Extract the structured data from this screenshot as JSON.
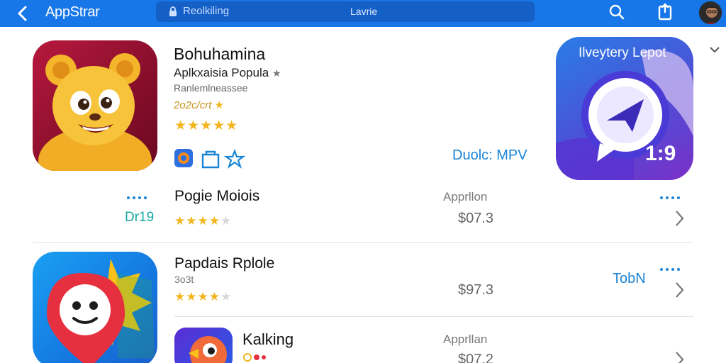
{
  "topbar": {
    "brand": "AppStrar",
    "search_placeholder": "Reolkiling",
    "search_center": "Lavrie",
    "icons": [
      "back-chevron-icon",
      "lock-icon",
      "search-icon",
      "share-icon",
      "avatar"
    ]
  },
  "featured": {
    "title": "Bohuhamina",
    "subtitle": "Aplkxaisia Popula",
    "small": "Ranlemlneassee",
    "year_text": "2o2c/crt",
    "rating_stars": 5,
    "promo": "Duolc: MPV",
    "big_card": {
      "title": "Ilveytery Lepot",
      "number": "1:9"
    }
  },
  "list": [
    {
      "title": "Pogie Moiois",
      "category": "Apprllon",
      "price": "$07.3",
      "rating": 4,
      "left_label": "Dr19"
    },
    {
      "title": "Papdais Rplole",
      "subtitle": "3o3t",
      "price": "$97.3",
      "rating": 3.5,
      "tag": "TobN"
    },
    {
      "title": "Kalking",
      "category": "Apprllan",
      "price": "$07.2"
    }
  ],
  "colors": {
    "bar": "#1877e8",
    "star": "#f2b51d",
    "link": "#1a84d6",
    "teal": "#17a9a0"
  }
}
